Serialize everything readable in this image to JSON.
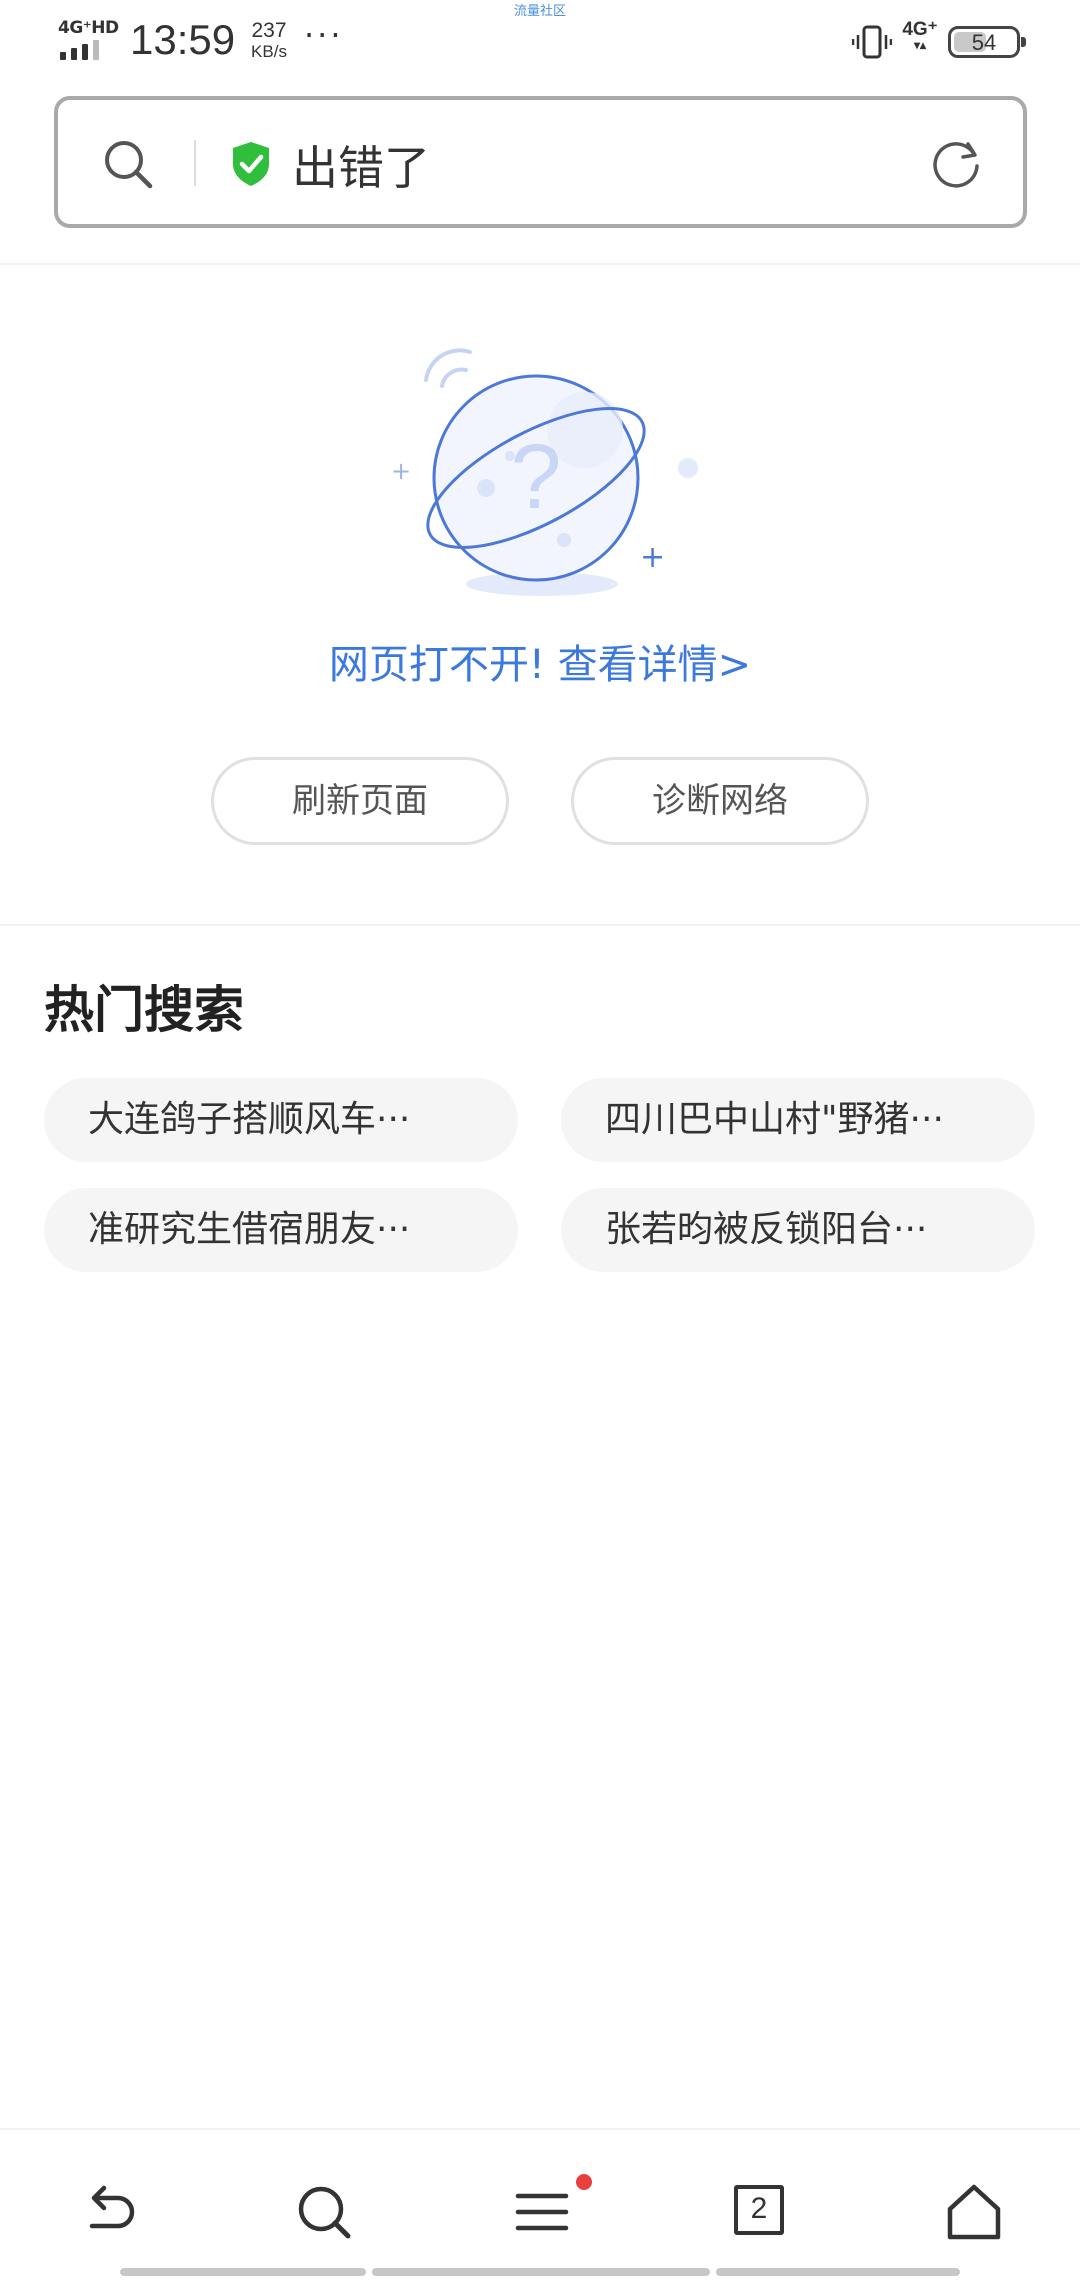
{
  "status_bar": {
    "network_left": "4G⁺HD",
    "time": "13:59",
    "speed_value": "237",
    "speed_unit": "KB/s",
    "more": "···",
    "center_text": "流量社区",
    "network_right": "4G⁺",
    "network_right_arrows": "▾▴",
    "battery": "54"
  },
  "address_bar": {
    "title": "出错了",
    "search_icon": "search-icon",
    "secure_icon": "shield-check-icon",
    "refresh_icon": "refresh-icon",
    "secure_color": "#2fbf3c"
  },
  "error": {
    "message": "网页打不开!",
    "details_link": "查看详情>",
    "illustration": "planet-question-icon",
    "link_color": "#3b79e0"
  },
  "buttons": {
    "refresh": "刷新页面",
    "diagnose": "诊断网络"
  },
  "hot_search": {
    "title": "热门搜索",
    "items": [
      "大连鸽子搭顺风车···",
      "四川巴中山村\"野猪···",
      "准研究生借宿朋友···",
      "张若昀被反锁阳台···"
    ]
  },
  "bottom_nav": {
    "back_icon": "back-icon",
    "search_icon": "search-icon",
    "menu_icon": "menu-icon",
    "tab_count": "2",
    "home_icon": "home-icon",
    "badge_color": "#e8403c"
  }
}
